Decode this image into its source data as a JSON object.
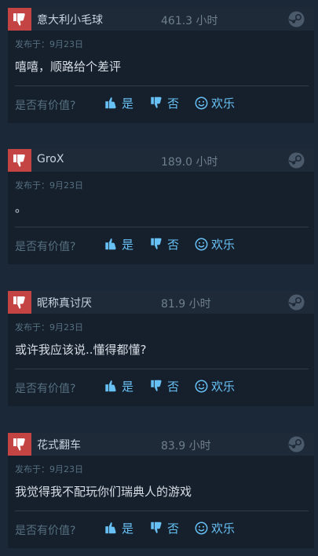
{
  "reviews": [
    {
      "username": "意大利小毛球",
      "hours": "461.3 小时",
      "posted": "发布于：9月23日",
      "text": "嘻嘻，顺路给个差评",
      "helpful_label": "是否有价值?",
      "yes_label": "是",
      "no_label": "否",
      "funny_label": "欢乐"
    },
    {
      "username": "GroX",
      "hours": "189.0 小时",
      "posted": "发布于：9月23日",
      "text": "。",
      "helpful_label": "是否有价值?",
      "yes_label": "是",
      "no_label": "否",
      "funny_label": "欢乐"
    },
    {
      "username": "昵称真讨厌",
      "hours": "81.9 小时",
      "posted": "发布于：9月23日",
      "text": "或许我应该说..懂得都懂?",
      "helpful_label": "是否有价值?",
      "yes_label": "是",
      "no_label": "否",
      "funny_label": "欢乐"
    },
    {
      "username": "花式翻车",
      "hours": "83.9 小时",
      "posted": "发布于：9月23日",
      "text": "我觉得我不配玩你们瑞典人的游戏",
      "helpful_label": "是否有价值?",
      "yes_label": "是",
      "no_label": "否",
      "funny_label": "欢乐"
    }
  ],
  "colors": {
    "background": "#1b2838",
    "card": "#16202d",
    "not_recommended": "#c44343",
    "link_blue": "#67c1f5"
  },
  "icons": {
    "recommendation": "thumbs-down-icon",
    "platform": "steam-logo-icon",
    "vote_yes": "thumbs-up-icon",
    "vote_no": "thumbs-down-icon",
    "vote_funny": "smiley-icon"
  }
}
